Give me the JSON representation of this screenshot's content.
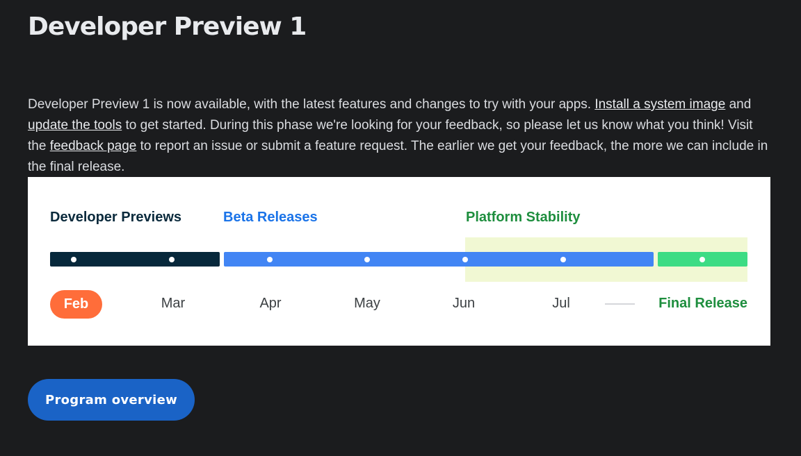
{
  "page": {
    "title": "Developer Preview 1"
  },
  "intro": {
    "part1": "Developer Preview 1 is now available, with the latest features and changes to try with your apps. ",
    "link_install": "Install a system image",
    "part2": " and ",
    "link_tools": "update the tools",
    "part3": " to get started. During this phase we're looking for your feedback, so please let us know what you think! Visit the ",
    "link_feedback": "feedback page",
    "part4": " to report an issue or submit a feature request. The earlier we get your feedback, the more we can include in the final release."
  },
  "timeline": {
    "phases": {
      "developer_previews": "Developer Previews",
      "beta_releases": "Beta Releases",
      "platform_stability": "Platform Stability"
    },
    "months": [
      "Feb",
      "Mar",
      "Apr",
      "May",
      "Jun",
      "Jul"
    ],
    "current_month": "Feb",
    "final_release": "Final Release",
    "colors": {
      "developer_previews": "#07283b",
      "beta_releases": "#4285f4",
      "final_release": "#3ddc84",
      "current_month": "#ff6d3a",
      "stability_band": "#f1f8d3"
    }
  },
  "cta": {
    "label": "Program overview"
  }
}
